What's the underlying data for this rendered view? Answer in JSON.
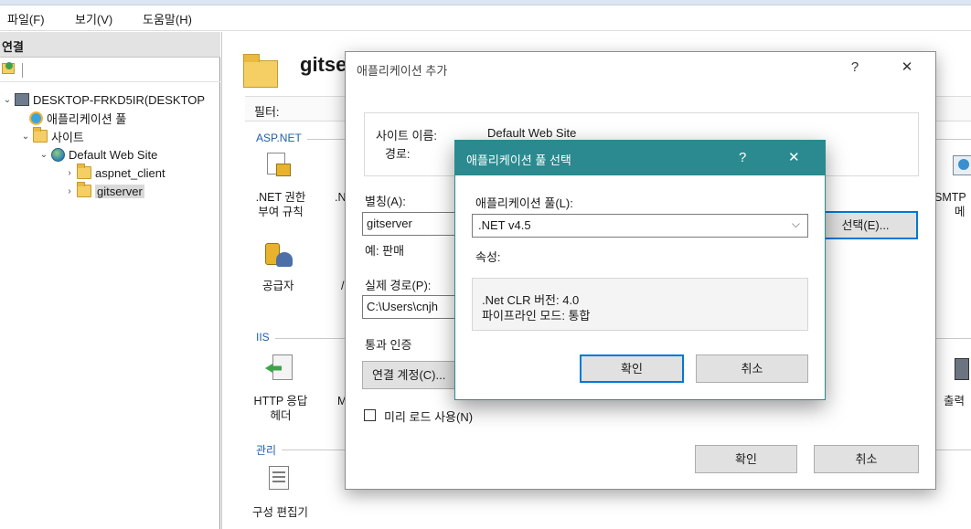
{
  "menu": [
    "파일(F)",
    "보기(V)",
    "도움말(H)"
  ],
  "connections": {
    "header": "연결",
    "tree": {
      "server": "DESKTOP-FRKD5IR(DESKTOP",
      "app_pools": "애플리케이션 풀",
      "sites": "사이트",
      "default_site": "Default Web Site",
      "child1": "aspnet_client",
      "child2": "gitserver"
    }
  },
  "main": {
    "title": "gitse",
    "filter_label": "필터:",
    "sections": {
      "aspnet": "ASP.NET",
      "iis": "IIS",
      "manage": "관리"
    },
    "features": {
      "net_trust": "NET 권한\n부여 규칙",
      "net_trust_line1": ".NET 권한",
      "net_trust_line2": "부여 규칙",
      "providers": "공급자",
      "http_headers_line1": "HTTP 응답",
      "http_headers_line2": "헤더",
      "config_editor": "구성 편집기",
      "smtp_line1": "SMTP",
      "smtp_line2": "메",
      "output": "출력",
      "trunc_n": ".N",
      "trunc_m": "M",
      "trunc_slash": "/"
    }
  },
  "add_app_dialog": {
    "title": "애플리케이션 추가",
    "help_btn": "?",
    "close_btn": "✕",
    "site_name_label": "사이트 이름:",
    "site_name_value": "Default Web Site",
    "path_label": "경로:",
    "alias_label": "별칭(A):",
    "alias_value": "gitserver",
    "example_text": "예: 판매",
    "physical_path_label": "실제 경로(P):",
    "physical_path_value": "C:\\Users\\cnjh",
    "pass_auth_label": "통과 인증",
    "connect_as_btn": "연결 계정(C)...",
    "select_btn": "선택(E)...",
    "preload_label": "미리 로드 사용(N)",
    "ok_btn": "확인",
    "cancel_btn": "취소"
  },
  "pool_dialog": {
    "title": "애플리케이션 풀 선택",
    "help_btn": "?",
    "close_btn": "✕",
    "pool_label": "애플리케이션 풀(L):",
    "pool_value": ".NET v4.5",
    "props_label": "속성:",
    "clr_version": ".Net CLR 버전: 4.0",
    "pipeline_mode": "파이프라인 모드: 통합",
    "ok_btn": "확인",
    "cancel_btn": "취소"
  },
  "colors": {
    "pool_title_bg": "#2a8a8f",
    "focus_border": "#0078d7",
    "section_label": "#1f5fa8"
  }
}
